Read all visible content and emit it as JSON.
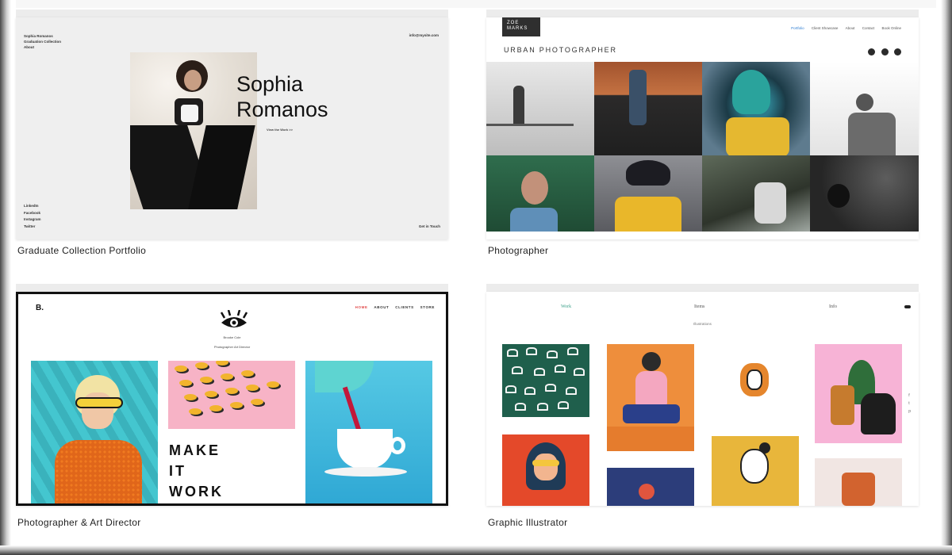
{
  "templates": [
    {
      "title": "Graduate Collection Portfolio",
      "preview": {
        "nav_name": "Sophia Romanos",
        "nav_links": [
          "Graduation Collection",
          "About"
        ],
        "email": "info@mysite.com",
        "headline_line1": "Sophia",
        "headline_line2": "Romanos",
        "tagline": "View the Work >>",
        "social_links": [
          "LinkedIn",
          "Facebook",
          "Instagram",
          "Twitter"
        ],
        "cta": "Get in Touch"
      }
    },
    {
      "title": "Photographer",
      "preview": {
        "logo_line1": "ZOE",
        "logo_line2": "MARKS",
        "menu": [
          "Portfolio",
          "Client Showcase",
          "About",
          "Contact",
          "Book Online"
        ],
        "site_title": "URBAN PHOTOGRAPHER",
        "social_icons": [
          "facebook-icon",
          "twitter-icon",
          "instagram-icon"
        ]
      }
    },
    {
      "title": "Photographer & Art Director",
      "preview": {
        "logo": "B.",
        "menu": [
          "HOME",
          "ABOUT",
          "CLIENTS",
          "STORE"
        ],
        "name": "Brooke Cole",
        "role": "Photographer Art Director",
        "headline": [
          "MAKE",
          "IT",
          "WORK"
        ]
      }
    },
    {
      "title": "Graphic Illustrator",
      "preview": {
        "nav": [
          "Work",
          "Items",
          "Info"
        ],
        "subtitle": "Illustrations",
        "side_icons": [
          "f",
          "t",
          "p"
        ]
      }
    }
  ],
  "colors": {
    "photographer_active_link": "#2d7dd2",
    "art_director_active_link": "#e14a4a",
    "illustrator_active_link": "#3da08a"
  }
}
